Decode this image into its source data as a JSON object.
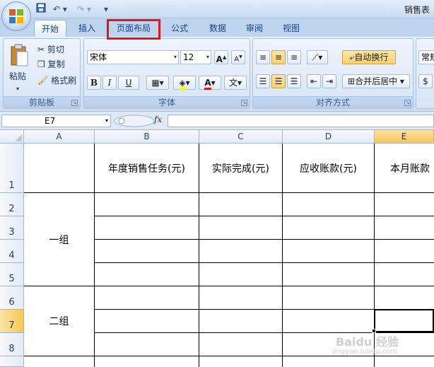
{
  "window": {
    "title": "销售表"
  },
  "tabs": [
    {
      "label": "开始",
      "active": true
    },
    {
      "label": "插入"
    },
    {
      "label": "页面布局",
      "highlighted": true
    },
    {
      "label": "公式"
    },
    {
      "label": "数据"
    },
    {
      "label": "审阅"
    },
    {
      "label": "视图"
    }
  ],
  "ribbon": {
    "clipboard": {
      "group_label": "剪贴板",
      "paste": "粘贴",
      "cut": "剪切",
      "copy": "复制",
      "format_painter": "格式刷"
    },
    "font": {
      "group_label": "字体",
      "font_name": "宋体",
      "font_size": "12",
      "grow": "A",
      "shrink": "A",
      "bold": "B",
      "italic": "I",
      "underline": "U",
      "font_color_glyph": "A",
      "phonetic": "文"
    },
    "alignment": {
      "group_label": "对齐方式",
      "wrap_text": "自动换行",
      "merge_center": "合并后居中"
    },
    "number": {
      "format_value": "常规"
    }
  },
  "formula_bar": {
    "name_box": "E7",
    "fx": "fx",
    "value": ""
  },
  "sheet": {
    "columns": [
      "A",
      "B",
      "C",
      "D",
      "E"
    ],
    "rows": [
      "1",
      "2",
      "3",
      "4",
      "5",
      "6",
      "7",
      "8"
    ],
    "selected_cell": "E7",
    "header_row": [
      "年度销售任务(元)",
      "实际完成(元)",
      "应收账款(元)",
      "本月账款"
    ],
    "groups": [
      "一组",
      "二组"
    ]
  },
  "watermark": {
    "text": "Baidu 经验",
    "sub": "jingyan.baidu.com"
  },
  "colors": {
    "highlight_red": "#e3151c",
    "selection_gold": "#f8c755",
    "ribbon_blue": "#dae6f5"
  }
}
